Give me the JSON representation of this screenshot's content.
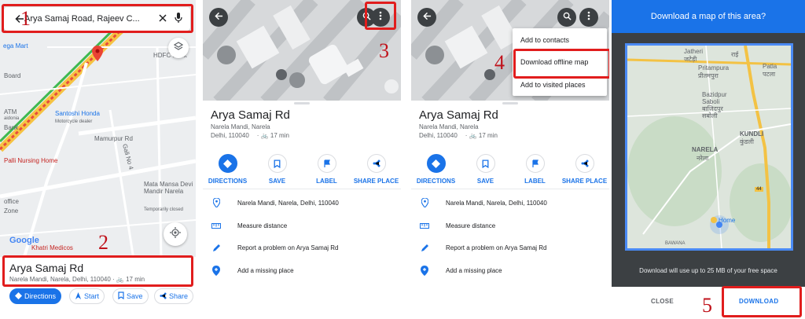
{
  "step_numbers": [
    "1",
    "2",
    "3",
    "4",
    "5"
  ],
  "colors": {
    "accent": "#1a73e8",
    "highlight": "#e11d1d",
    "dialog_header": "#1a73e8",
    "dim_bg": "#3c4043"
  },
  "panel1": {
    "search_query": "Arya Samaj Road, Rajeev C...",
    "map_labels": {
      "ega_mart": "ega Mart",
      "hdfc_bank": "HDFC Bank",
      "boarding": "Board",
      "santoshi_honda": "Santoshi Honda",
      "santoshi_honda_sub": "Motorcycle dealer",
      "atm": "ATM",
      "atm_sub": "aidonia",
      "bank": "Bank",
      "pilli_nursing_home": "Palli Nursing Home",
      "mamurpur_rd": "Mamurpur Rd",
      "gali_no_4": "Gali No 4",
      "mandir": "Mata Mansa Devi\nMandir Narela",
      "mandir_sub": "Temporarily closed",
      "office": "office",
      "zone": "Zone",
      "khatri_medicos": "Khatri Medicos",
      "google": "Google"
    },
    "place_title": "Arya Samaj Rd",
    "place_sub": "Narela Mandi, Narela, Delhi, 110040 · 🚲 17 min",
    "chips": [
      "Directions",
      "Start",
      "Save",
      "Share"
    ]
  },
  "place_card": {
    "title": "Arya Samaj Rd",
    "address_line1": "Narela Mandi, Narela",
    "address_line2": "Delhi, 110040",
    "travel_time": "17 min",
    "actions": [
      "DIRECTIONS",
      "SAVE",
      "LABEL",
      "SHARE PLACE"
    ],
    "rows": [
      "Narela Mandi, Narela, Delhi, 110040",
      "Measure distance",
      "Report a problem on Arya Samaj Rd",
      "Add a missing place"
    ]
  },
  "menu": {
    "items": [
      "Add to contacts",
      "Download offline map",
      "Add to visited places"
    ]
  },
  "download_dialog": {
    "title": "Download a map of this area?",
    "map_labels": {
      "jatheri": "Jatheri",
      "jatheri_hi": "जटेड़ी",
      "rai": "राई",
      "patla": "Patla",
      "patla_hi": "पटला",
      "pritampura": "Pritampura",
      "pritampura_hi": "प्रीतमपुरा",
      "bazidpur": "Bazidpur\nSaboli\nबाजिदपुर\nसबोली",
      "kundli": "KUNDLI",
      "kundli_hi": "कुंडली",
      "narela": "NARELA",
      "narela_hi": "नरेला",
      "home": "Home",
      "bawana": "BAWANA",
      "highway": "44"
    },
    "note": "Download will use up to 25 MB of your free space",
    "close_label": "CLOSE",
    "download_label": "DOWNLOAD"
  }
}
